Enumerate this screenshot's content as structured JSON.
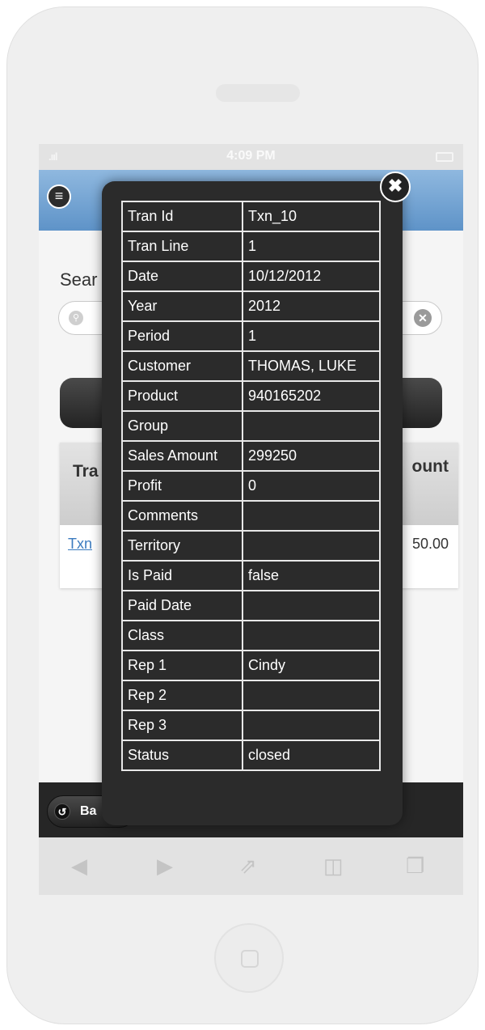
{
  "status_bar": {
    "time": "4:09 PM",
    "signal": ".ııl"
  },
  "page": {
    "search_label": "Sear",
    "table_header": {
      "col1": "Tra Id",
      "col2": "ount"
    },
    "row": {
      "col1": "Txn",
      "col2": "50.00"
    },
    "back_label": "Ba"
  },
  "popup": {
    "close_glyph": "✖",
    "rows": [
      {
        "label": "Tran Id",
        "value": "Txn_10"
      },
      {
        "label": "Tran Line",
        "value": "1"
      },
      {
        "label": "Date",
        "value": "10/12/2012"
      },
      {
        "label": "Year",
        "value": "2012"
      },
      {
        "label": "Period",
        "value": "1"
      },
      {
        "label": "Customer",
        "value": "THOMAS, LUKE"
      },
      {
        "label": "Product",
        "value": "940165202"
      },
      {
        "label": "Group",
        "value": ""
      },
      {
        "label": "Sales Amount",
        "value": "299250"
      },
      {
        "label": "Profit",
        "value": "0"
      },
      {
        "label": "Comments",
        "value": ""
      },
      {
        "label": "Territory",
        "value": ""
      },
      {
        "label": "Is Paid",
        "value": "false"
      },
      {
        "label": "Paid Date",
        "value": ""
      },
      {
        "label": "Class",
        "value": ""
      },
      {
        "label": "Rep 1",
        "value": "Cindy"
      },
      {
        "label": "Rep 2",
        "value": ""
      },
      {
        "label": "Rep 3",
        "value": ""
      },
      {
        "label": "Status",
        "value": "closed"
      }
    ]
  },
  "icons": {
    "menu": "menu-icon",
    "search": "search-icon",
    "clear": "clear-icon",
    "back": "back-icon",
    "browser_back": "triangle-left-icon",
    "browser_forward": "triangle-right-icon",
    "share": "share-icon",
    "bookmarks": "book-icon",
    "tabs": "tabs-icon"
  },
  "colors": {
    "header_blue": "#5e93c8",
    "popup_bg": "#2b2b2b",
    "link_blue": "#3b7bbf"
  }
}
